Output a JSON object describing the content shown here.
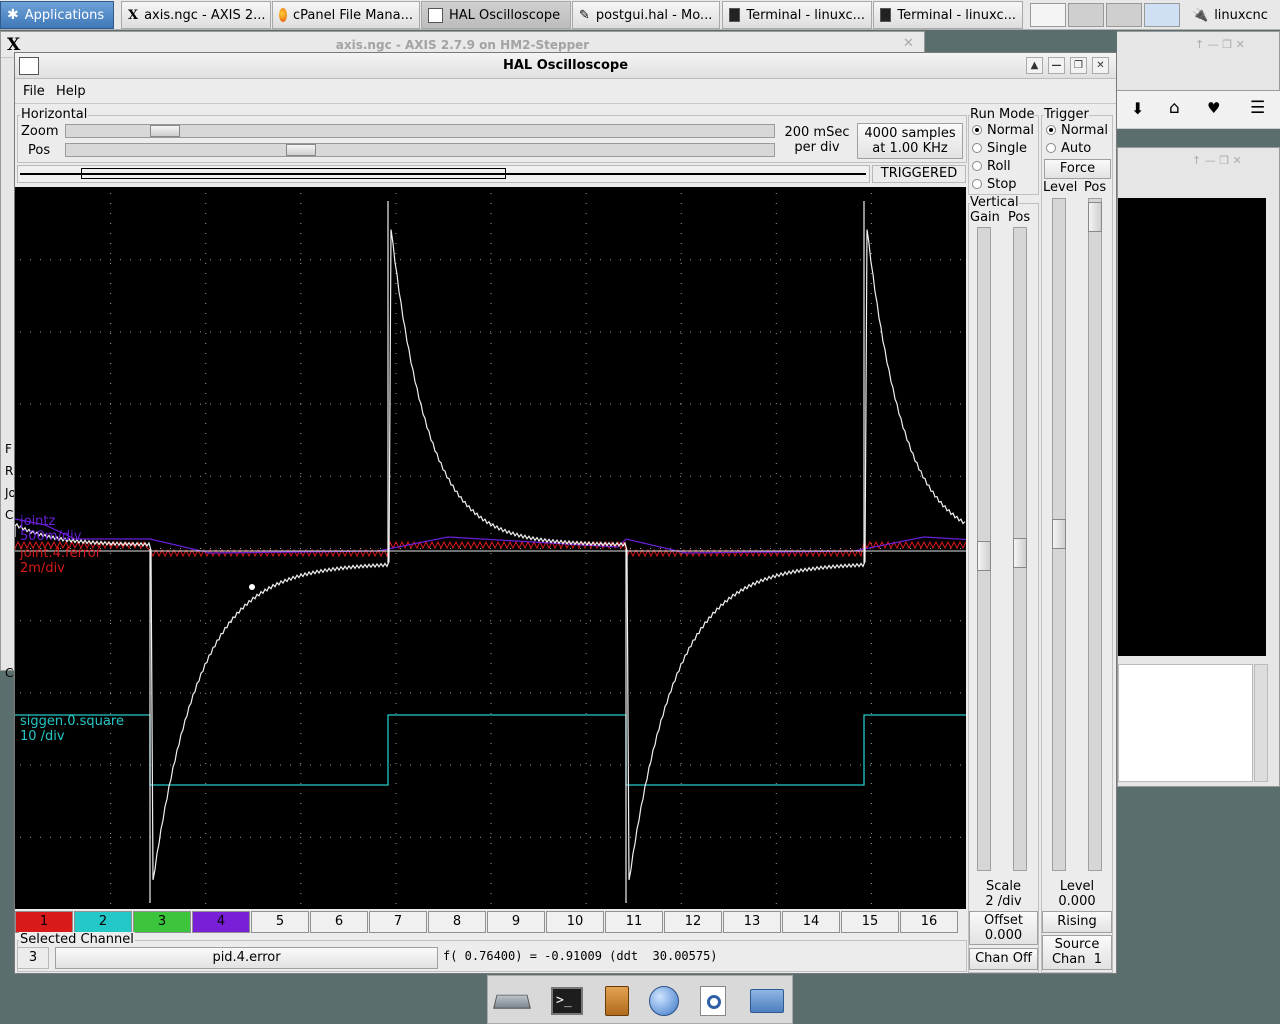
{
  "taskbar": {
    "apps_label": "Applications",
    "tasks": [
      {
        "label": "axis.ngc - AXIS 2..."
      },
      {
        "label": "cPanel File Mana..."
      },
      {
        "label": "HAL Oscilloscope"
      },
      {
        "label": "postgui.hal - Mo..."
      },
      {
        "label": "Terminal - linuxc..."
      },
      {
        "label": "Terminal - linuxc..."
      }
    ],
    "tray_label": "linuxcnc"
  },
  "background": {
    "axis_title": "axis.ngc - AXIS 2.7.9 on HM2-Stepper",
    "axis_side_chars": [
      "F",
      "R",
      "Jo",
      "C",
      "C"
    ]
  },
  "scope": {
    "title": "HAL Oscilloscope",
    "menu": {
      "file": "File",
      "help": "Help"
    },
    "horizontal": {
      "group_label": "Horizontal",
      "zoom_label": "Zoom",
      "pos_label": "Pos",
      "rate_line1": "200 mSec",
      "rate_line2": "per div",
      "samples_line1": "4000 samples",
      "samples_line2": "at 1.00 KHz",
      "status": "TRIGGERED"
    },
    "run_mode": {
      "label": "Run Mode",
      "options": [
        "Normal",
        "Single",
        "Roll",
        "Stop"
      ],
      "selected": "Normal"
    },
    "trigger": {
      "label": "Trigger",
      "options": [
        "Normal",
        "Auto"
      ],
      "selected": "Normal",
      "force_label": "Force",
      "level_label": "Level",
      "pos_label": "Pos",
      "level_value_label": "Level",
      "level_value": "0.000",
      "edge": "Rising",
      "source_line1": "Source",
      "source_line2": "Chan  1"
    },
    "vertical": {
      "label": "Vertical",
      "gain_label": "Gain",
      "pos_label": "Pos",
      "scale_label": "Scale",
      "scale_value": "2 /div",
      "offset_label": "Offset",
      "offset_value": "0.000",
      "chan_off_label": "Chan Off"
    },
    "traces": [
      {
        "name": "pid.4.error",
        "scale": "2 /div",
        "color": "#f0f0f0"
      },
      {
        "name": "jointz",
        "scale": "500m/div",
        "color": "#6a1fd8"
      },
      {
        "name": "joint.4.ferror",
        "scale": "2m/div",
        "color": "#d81a1a"
      },
      {
        "name": "siggen.0.square",
        "scale": "10 /div",
        "color": "#25c8c8"
      }
    ],
    "channels": [
      {
        "label": "1",
        "color": "#d81a1a"
      },
      {
        "label": "2",
        "color": "#25c8c8"
      },
      {
        "label": "3",
        "color": "#3cc43c"
      },
      {
        "label": "4",
        "color": "#7a1fd8"
      },
      {
        "label": "5"
      },
      {
        "label": "6"
      },
      {
        "label": "7"
      },
      {
        "label": "8"
      },
      {
        "label": "9"
      },
      {
        "label": "10"
      },
      {
        "label": "11"
      },
      {
        "label": "12"
      },
      {
        "label": "13"
      },
      {
        "label": "14"
      },
      {
        "label": "15"
      },
      {
        "label": "16"
      }
    ],
    "selected_channel": {
      "label": "Selected Channel",
      "number": "3",
      "name": "pid.4.error",
      "readout": "f( 0.76400) = -0.91009 (ddt  30.00575)"
    }
  },
  "dock": {
    "icons": [
      "drive-icon",
      "terminal-icon",
      "file-cabinet-icon",
      "web-browser-icon",
      "search-icon",
      "folder-icon"
    ]
  }
}
